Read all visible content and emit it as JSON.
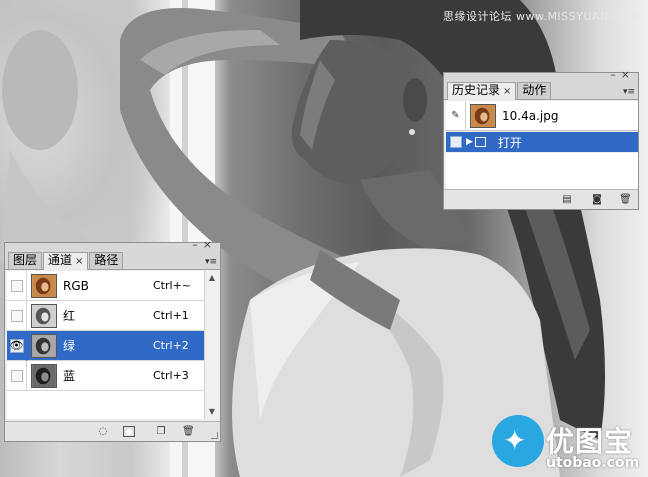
{
  "watermark_top": "思缘设计论坛 www.MISSYUAN.COM",
  "brand": {
    "name_cn": "优图宝",
    "domain": "utobao.com",
    "color": "#29a7e1"
  },
  "channels_panel": {
    "tabs": [
      {
        "label": "图层"
      },
      {
        "label": "通道",
        "active": true
      },
      {
        "label": "路径"
      }
    ],
    "channels": [
      {
        "name": "RGB",
        "shortcut": "Ctrl+~",
        "visible": false,
        "selected": false,
        "thumb": "color"
      },
      {
        "name": "红",
        "shortcut": "Ctrl+1",
        "visible": false,
        "selected": false,
        "thumb": "gray-light"
      },
      {
        "name": "绿",
        "shortcut": "Ctrl+2",
        "visible": true,
        "selected": true,
        "thumb": "gray-mid"
      },
      {
        "name": "蓝",
        "shortcut": "Ctrl+3",
        "visible": false,
        "selected": false,
        "thumb": "gray-dark"
      }
    ],
    "tools": [
      "load-channel-as-selection-icon",
      "save-selection-as-channel-icon",
      "new-channel-icon",
      "trash-icon"
    ]
  },
  "history_panel": {
    "tabs": [
      {
        "label": "历史记录",
        "active": true
      },
      {
        "label": "动作"
      }
    ],
    "snapshot": {
      "file_name": "10.4a.jpg"
    },
    "states": [
      {
        "label": "打开",
        "selected": true
      }
    ],
    "tools": [
      "new-document-from-state-icon",
      "create-snapshot-icon",
      "trash-icon"
    ]
  },
  "colors": {
    "selection": "#3169c6",
    "panel_bg": "#ededed"
  }
}
